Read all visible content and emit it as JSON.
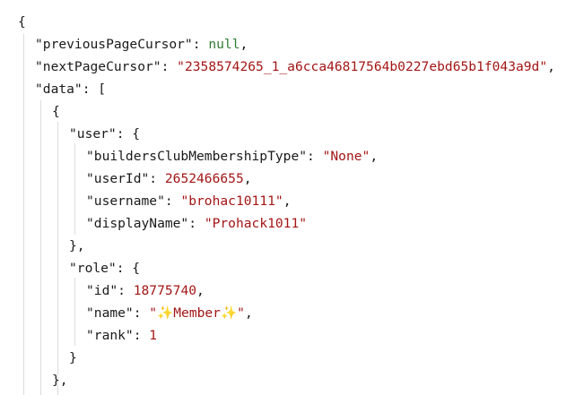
{
  "json": {
    "open_brace": "{",
    "previousPageCursor": {
      "key": "\"previousPageCursor\"",
      "value": "null"
    },
    "nextPageCursor": {
      "key": "\"nextPageCursor\"",
      "value": "\"2358574265_1_a6cca46817564b0227ebd65b1f043a9d\""
    },
    "data_key": "\"data\"",
    "array_open": "[",
    "item_open": "{",
    "user_key": "\"user\"",
    "user": {
      "builders": {
        "key": "\"buildersClubMembershipType\"",
        "value": "\"None\""
      },
      "userId": {
        "key": "\"userId\"",
        "value": "2652466655"
      },
      "username": {
        "key": "\"username\"",
        "value": "\"brohac10111\""
      },
      "displayName": {
        "key": "\"displayName\"",
        "value": "\"Prohack1011\""
      }
    },
    "user_close": "},",
    "role_key": "\"role\"",
    "role": {
      "id": {
        "key": "\"id\"",
        "value": "18775740"
      },
      "name": {
        "key": "\"name\"",
        "value": "\"✨Member✨\""
      },
      "rank": {
        "key": "\"rank\"",
        "value": "1"
      }
    },
    "role_close": "}",
    "item_close": "},"
  }
}
